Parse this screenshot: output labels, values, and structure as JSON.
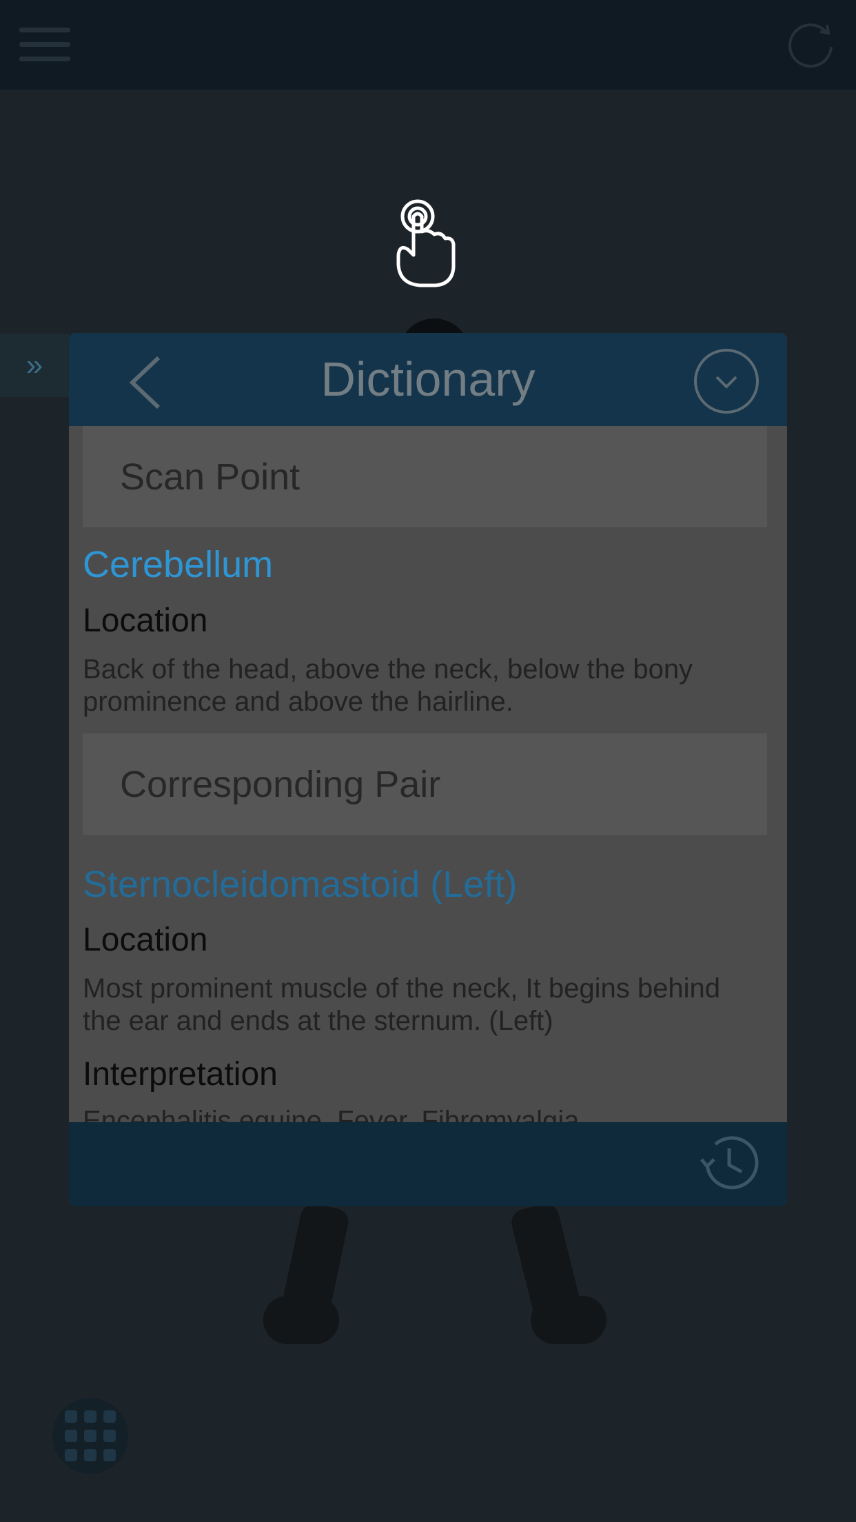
{
  "app": {
    "side_tab_glyph": "»"
  },
  "dictionary": {
    "title": "Dictionary",
    "section_scan": "Scan Point",
    "primary_term": "Cerebellum",
    "primary_location_label": "Location",
    "primary_location_text": "Back of the head, above the neck, below the bony prominence and above the hairline.",
    "section_pair": "Corresponding  Pair",
    "pair_term": "Sternocleidomastoid (Left)",
    "pair_location_label": "Location",
    "pair_location_text": "Most prominent muscle of the neck, It begins behind the ear and ends at the sternum. (Left)",
    "interpretation_label": "Interpretation",
    "interpretation_text": "Encephalitis equine, Fever, Fibromyalgia"
  },
  "colors": {
    "header": "#13344a",
    "accent_term": "#2f96d6",
    "secondary_term": "#236c99",
    "footer": "#0f2a3b"
  },
  "icons": {
    "menu": "menu-icon",
    "refresh": "refresh-icon",
    "tap": "tap-hand-icon",
    "back": "chevron-left-icon",
    "collapse": "chevron-down-circle-icon",
    "history": "history-icon",
    "grid": "grid-icon"
  }
}
